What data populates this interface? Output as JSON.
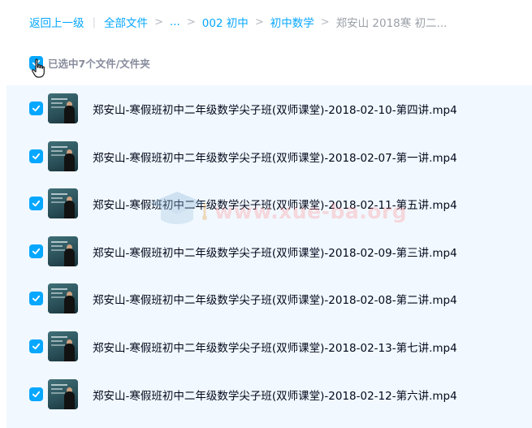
{
  "breadcrumb": {
    "back": "返回上一级",
    "separator": "|",
    "root": "全部文件",
    "ellipsis": "...",
    "level1": "002 初中",
    "level2": "初中数学",
    "current": "郑安山 2018寒 初二...",
    "arrow": ">"
  },
  "selection": {
    "label": "已选中7个文件/文件夹",
    "checked": true
  },
  "files": [
    {
      "name": "郑安山-寒假班初中二年级数学尖子班(双师课堂)-2018-02-10-第四讲.mp4",
      "checked": true
    },
    {
      "name": "郑安山-寒假班初中二年级数学尖子班(双师课堂)-2018-02-07-第一讲.mp4",
      "checked": true
    },
    {
      "name": "郑安山-寒假班初中二年级数学尖子班(双师课堂)-2018-02-11-第五讲.mp4",
      "checked": true
    },
    {
      "name": "郑安山-寒假班初中二年级数学尖子班(双师课堂)-2018-02-09-第三讲.mp4",
      "checked": true
    },
    {
      "name": "郑安山-寒假班初中二年级数学尖子班(双师课堂)-2018-02-08-第二讲.mp4",
      "checked": true
    },
    {
      "name": "郑安山-寒假班初中二年级数学尖子班(双师课堂)-2018-02-13-第七讲.mp4",
      "checked": true
    },
    {
      "name": "郑安山-寒假班初中二年级数学尖子班(双师课堂)-2018-02-12-第六讲.mp4",
      "checked": true
    }
  ],
  "watermark": {
    "text": "www.xue-ba.org"
  },
  "colors": {
    "accent": "#06a7ff",
    "list_bg": "#f1f8ff",
    "text": "#03081a",
    "muted": "#878c9c"
  }
}
